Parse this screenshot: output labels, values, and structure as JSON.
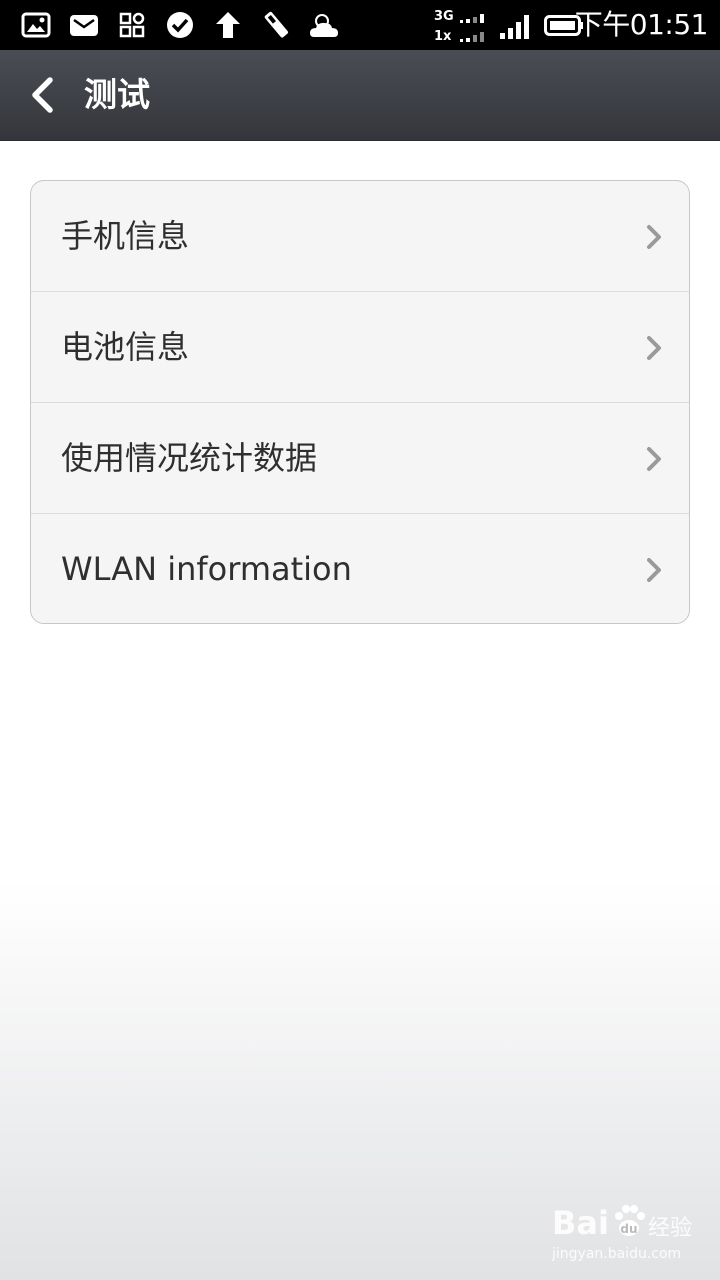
{
  "status_bar": {
    "network_top": "3G",
    "network_bottom": "1x",
    "time": "下午01:51"
  },
  "action_bar": {
    "title": "测试"
  },
  "list": {
    "items": [
      {
        "label": "手机信息"
      },
      {
        "label": "电池信息"
      },
      {
        "label": "使用情况统计数据"
      },
      {
        "label": "WLAN information"
      }
    ]
  },
  "watermark": {
    "brand": "Bai",
    "brand_suffix": "经验",
    "url": "jingyan.baidu.com"
  }
}
